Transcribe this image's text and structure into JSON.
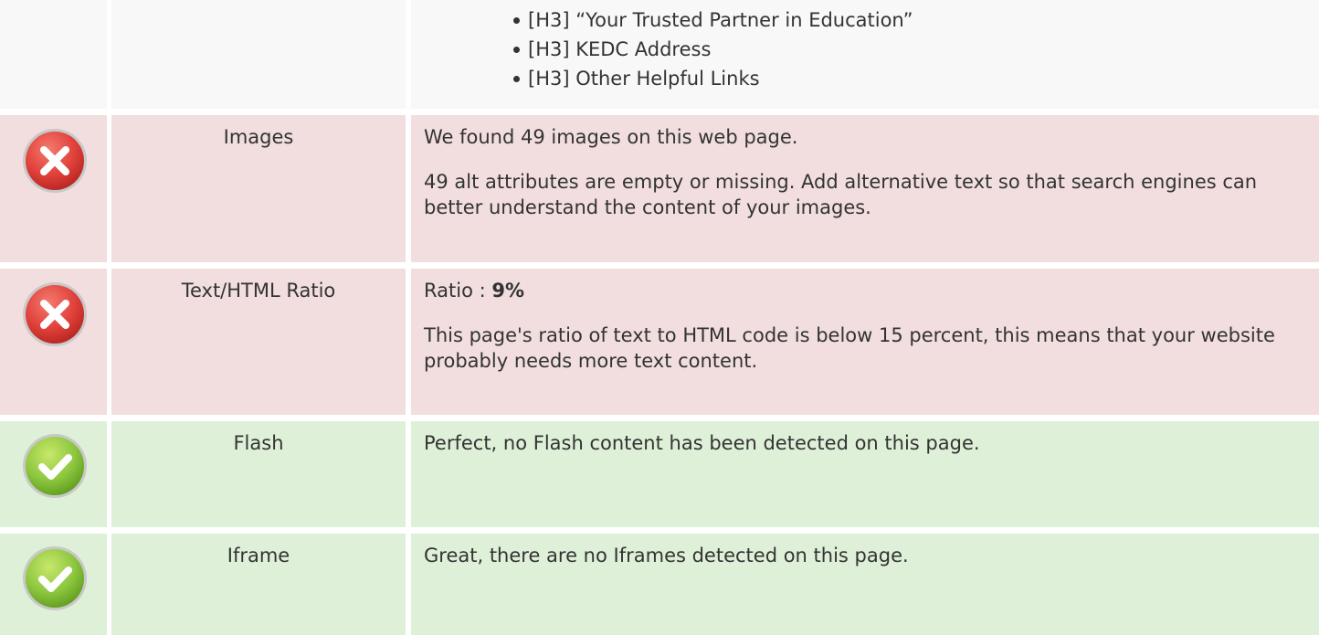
{
  "headings": {
    "items": [
      "[H3] “Your Trusted Partner in Education”",
      "[H3] KEDC Address",
      "[H3] Other Helpful Links"
    ]
  },
  "images": {
    "label": "Images",
    "status": "error",
    "status_icon": "error-x-icon",
    "line1": "We found 49 images on this web page.",
    "line2": "49 alt attributes are empty or missing. Add alternative text so that search engines can better understand the content of your images."
  },
  "ratio": {
    "label": "Text/HTML Ratio",
    "status": "error",
    "status_icon": "error-x-icon",
    "prefix": "Ratio : ",
    "value": "9%",
    "description": "This page's ratio of text to HTML code is below 15 percent, this means that your website probably needs more text content."
  },
  "flash": {
    "label": "Flash",
    "status": "success",
    "status_icon": "check-icon",
    "description": "Perfect, no Flash content has been detected on this page."
  },
  "iframe": {
    "label": "Iframe",
    "status": "success",
    "status_icon": "check-icon",
    "description": "Great, there are no Iframes detected on this page."
  },
  "colors": {
    "neutral_bg": "#f8f8f8",
    "error_bg": "#f2dede",
    "success_bg": "#dff0d8",
    "error_icon": "#e0403a",
    "success_icon": "#8cc63f"
  }
}
